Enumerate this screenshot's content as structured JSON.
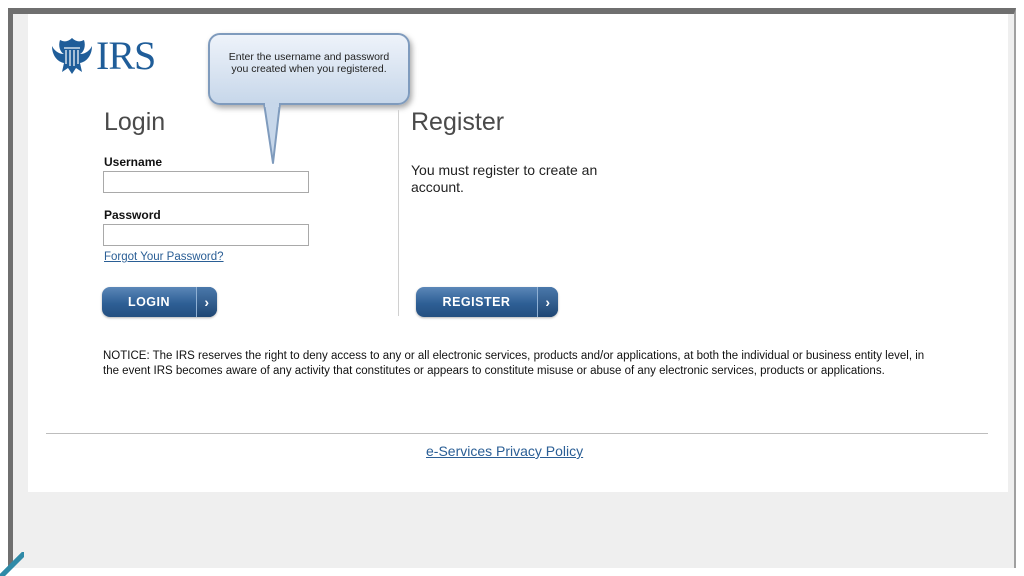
{
  "logo": {
    "text": "IRS",
    "icon": "eagle-logo-icon"
  },
  "callout": {
    "text": "Enter the username and password you created when you registered."
  },
  "login": {
    "title": "Login",
    "username_label": "Username",
    "username_value": "",
    "password_label": "Password",
    "password_value": "",
    "forgot_link": "Forgot Your Password?",
    "button_label": "LOGIN",
    "button_icon": "chevron-right-icon"
  },
  "register": {
    "title": "Register",
    "description": "You must register to create an account.",
    "button_label": "REGISTER",
    "button_icon": "chevron-right-icon"
  },
  "notice": "NOTICE: The IRS reserves the right to deny access to any or all electronic services, products and/or applications, at both the individual or business entity level, in the event IRS becomes aware of any activity that constitutes or appears to constitute misuse or abuse of any electronic services, products or applications.",
  "footer": {
    "privacy_link": "e-Services Privacy Policy"
  },
  "colors": {
    "brand_blue": "#1f5d99",
    "button_blue": "#2e5f95",
    "link_blue": "#2a5e95",
    "frame_gray": "#6f6f6f",
    "background_gray": "#efefef"
  }
}
